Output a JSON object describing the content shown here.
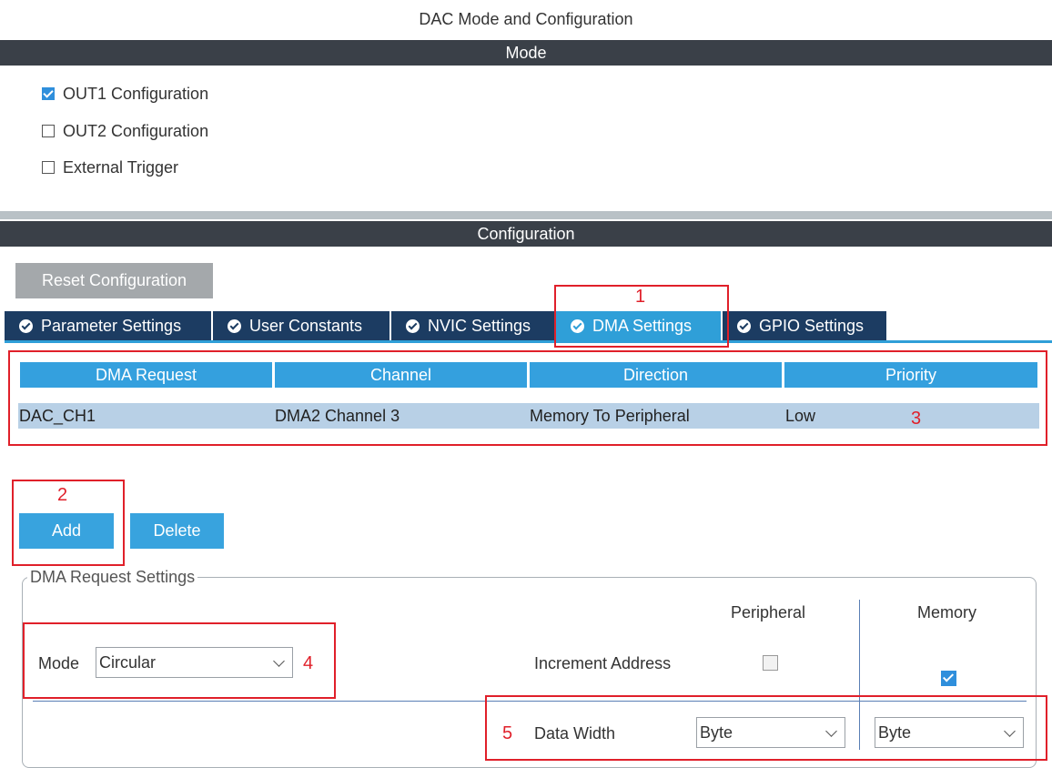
{
  "window": {
    "title": "DAC Mode and Configuration"
  },
  "mode_section": {
    "header": "Mode",
    "options": [
      {
        "label": "OUT1 Configuration",
        "checked": true
      },
      {
        "label": "OUT2 Configuration",
        "checked": false
      },
      {
        "label": "External Trigger",
        "checked": false
      }
    ]
  },
  "config_section": {
    "header": "Configuration",
    "reset_label": "Reset Configuration",
    "tabs": [
      {
        "label": "Parameter Settings",
        "icon": "check-circle-icon",
        "active": false
      },
      {
        "label": "User Constants",
        "icon": "check-circle-icon",
        "active": false
      },
      {
        "label": "NVIC Settings",
        "icon": "check-circle-icon",
        "active": false
      },
      {
        "label": "DMA Settings",
        "icon": "check-circle-icon",
        "active": true
      },
      {
        "label": "GPIO Settings",
        "icon": "check-circle-icon",
        "active": false
      }
    ]
  },
  "dma_table": {
    "columns": [
      "DMA Request",
      "Channel",
      "Direction",
      "Priority"
    ],
    "rows": [
      [
        "DAC_CH1",
        "DMA2 Channel 3",
        "Memory To Peripheral",
        "Low"
      ]
    ]
  },
  "buttons": {
    "add": "Add",
    "delete": "Delete"
  },
  "request_settings": {
    "legend": "DMA Request Settings",
    "mode_label": "Mode",
    "mode_value": "Circular",
    "col_peripheral": "Peripheral",
    "col_memory": "Memory",
    "increment_label": "Increment Address",
    "increment_peripheral": false,
    "increment_memory": true,
    "data_width_label": "Data Width",
    "data_width_peripheral": "Byte",
    "data_width_memory": "Byte"
  },
  "annotations": [
    "1",
    "2",
    "3",
    "4",
    "5"
  ],
  "colors": {
    "accent": "#2f9fd8",
    "tab_dark": "#1c3c62",
    "section_bar": "#3a4048",
    "annotation": "#e0202a"
  }
}
